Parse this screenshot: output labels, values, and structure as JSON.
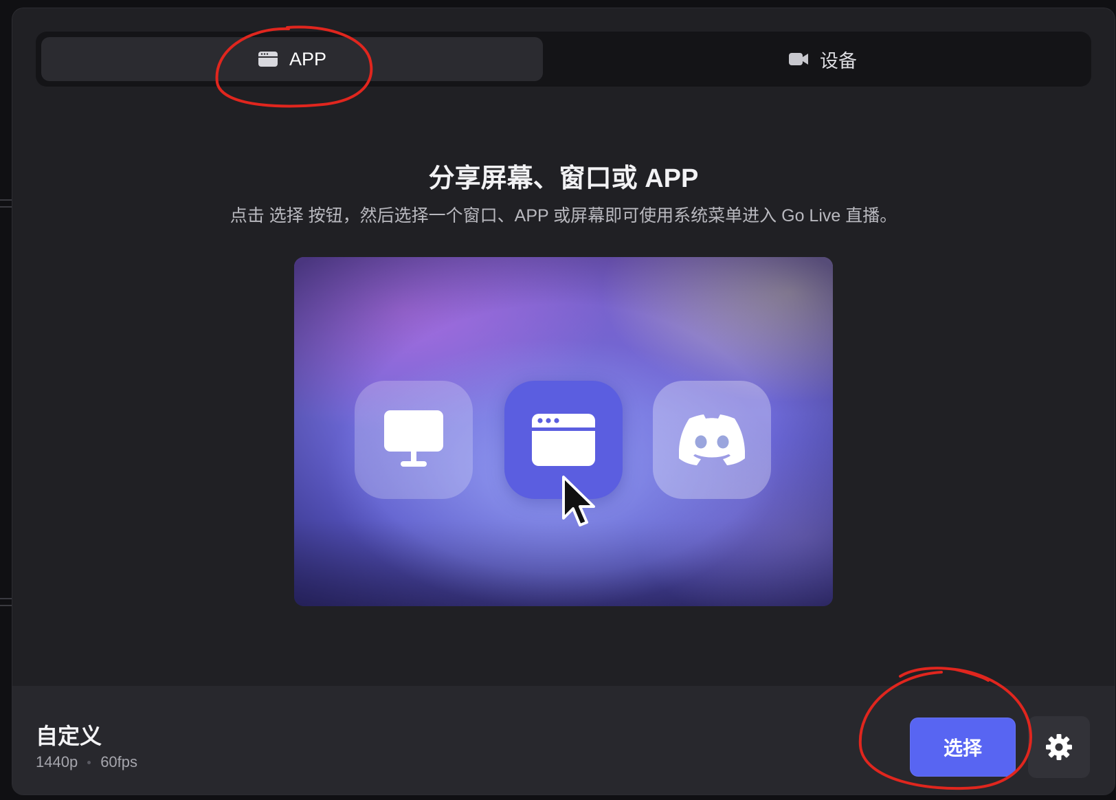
{
  "tabs": [
    {
      "label": "APP",
      "icon": "app-window-icon",
      "active": true
    },
    {
      "label": "设备",
      "icon": "camera-icon",
      "active": false
    }
  ],
  "main": {
    "title": "分享屏幕、窗口或 APP",
    "subtitle": "点击 选择 按钮，然后选择一个窗口、APP 或屏幕即可使用系统菜单进入 Go Live 直播。",
    "preview_icons": [
      "monitor-icon",
      "app-window-icon",
      "discord-icon"
    ]
  },
  "footer": {
    "preset_name": "自定义",
    "resolution": "1440p",
    "framerate": "60fps",
    "select_label": "选择",
    "settings_icon": "gear-icon"
  },
  "colors": {
    "accent": "#5865f2",
    "modal_bg": "#202024",
    "annotation": "#e0261e"
  }
}
